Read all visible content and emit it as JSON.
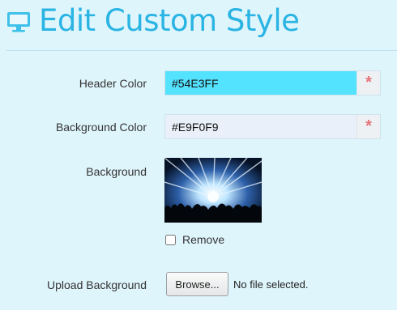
{
  "header": {
    "title": "Edit Custom Style",
    "icon": "monitor-icon"
  },
  "form": {
    "header_color": {
      "label": "Header Color",
      "value": "#54E3FF",
      "required_mark": "*",
      "swatch": "#54E3FF"
    },
    "background_color": {
      "label": "Background Color",
      "value": "#E9F0F9",
      "required_mark": "*",
      "swatch": "#E9F0F9"
    },
    "background": {
      "label": "Background",
      "remove_label": "Remove",
      "remove_checked": false
    },
    "upload": {
      "label": "Upload Background",
      "browse_label": "Browse...",
      "file_status": "No file selected."
    }
  },
  "colors": {
    "title": "#2ab4e3",
    "page_background": "#dff5fc",
    "required_asterisk": "#e5737a"
  }
}
